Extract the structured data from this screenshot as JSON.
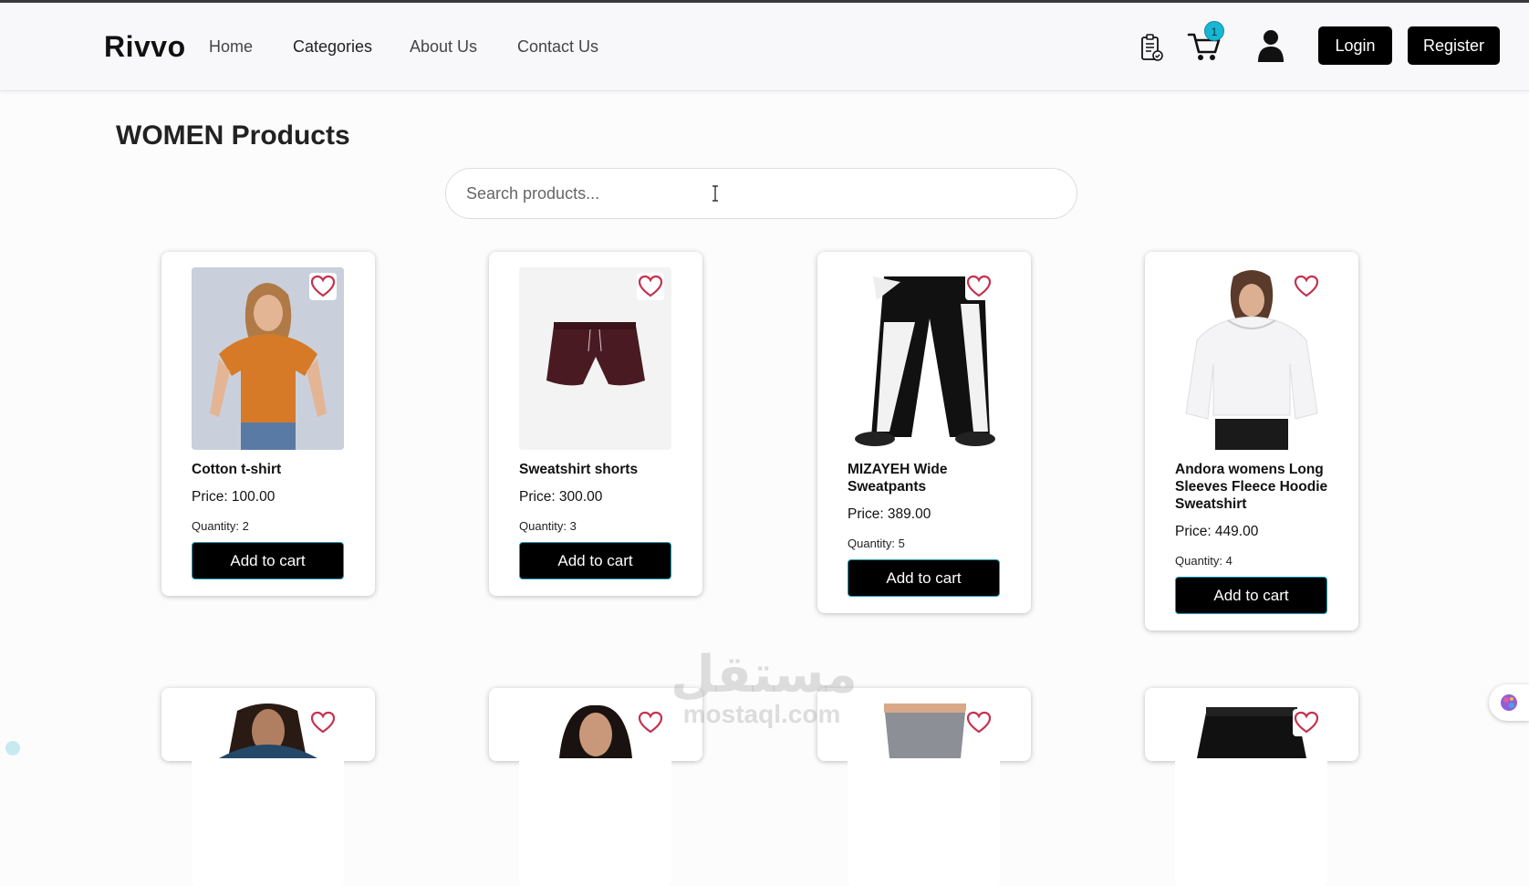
{
  "header": {
    "logo": "Rivvo",
    "nav": [
      "Home",
      "Categories",
      "About Us",
      "Contact Us"
    ],
    "cart_count": "1",
    "login_label": "Login",
    "register_label": "Register"
  },
  "main": {
    "title": "WOMEN Products",
    "search_placeholder": "Search products..."
  },
  "products": [
    {
      "name": "Cotton t-shirt",
      "price": "Price: 100.00",
      "quantity": "Quantity: 2",
      "button": "Add to cart"
    },
    {
      "name": "Sweatshirt shorts",
      "price": "Price: 300.00",
      "quantity": "Quantity: 3",
      "button": "Add to cart"
    },
    {
      "name": "MIZAYEH Wide Sweatpants",
      "price": "Price: 389.00",
      "quantity": "Quantity: 5",
      "button": "Add to cart"
    },
    {
      "name": "Andora womens Long Sleeves Fleece Hoodie Sweatshirt",
      "price": "Price: 449.00",
      "quantity": "Quantity: 4",
      "button": "Add to cart"
    }
  ],
  "watermark": {
    "arabic": "مستقل",
    "latin": "mostaql.com"
  },
  "colors": {
    "accent": "#17b6d4",
    "heart": "#c4324f",
    "button": "#000000"
  }
}
